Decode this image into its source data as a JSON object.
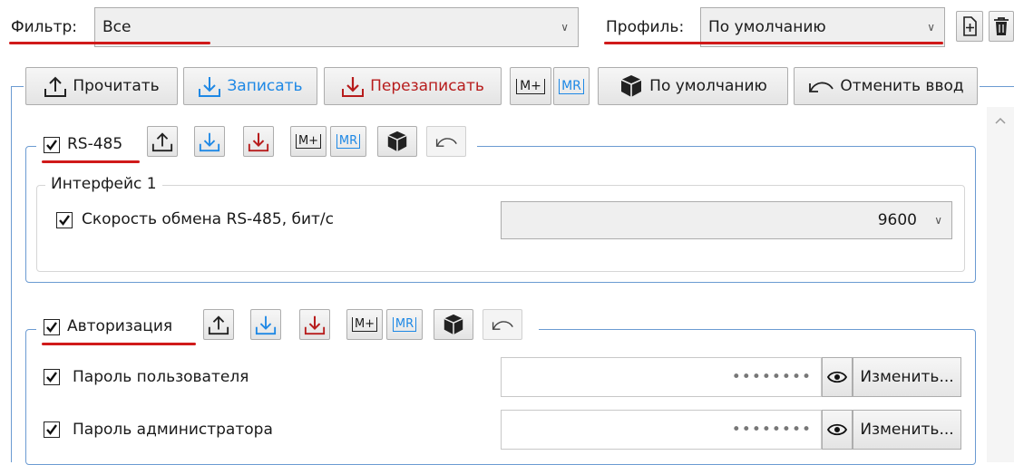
{
  "filter": {
    "label": "Фильтр:",
    "value": "Все"
  },
  "profile": {
    "label": "Профиль:",
    "value": "По умолчанию"
  },
  "toolbar": {
    "read": "Прочитать",
    "write": "Записать",
    "overwrite": "Перезаписать",
    "mem_store": "M+",
    "mem_recall": "MR",
    "defaults": "По умолчанию",
    "undo": "Отменить ввод"
  },
  "rs485": {
    "title": "RS-485",
    "mem_store": "M+",
    "mem_recall": "MR",
    "interface": {
      "title": "Интерфейс 1",
      "baud_label": "Скорость обмена RS-485, бит/с",
      "baud_value": "9600"
    }
  },
  "auth": {
    "title": "Авторизация",
    "mem_store": "M+",
    "mem_recall": "MR",
    "user_password_label": "Пароль пользователя",
    "admin_password_label": "Пароль администратора",
    "masked": "••••••••",
    "change": "Изменить..."
  },
  "icons": [
    "chevron-down-icon",
    "add-profile-icon",
    "trash-icon",
    "upload-icon",
    "download-icon",
    "cube-icon",
    "undo-icon",
    "eye-icon",
    "checkmark-icon",
    "scroll-up-icon"
  ],
  "colors": {
    "write_blue": "#1e88e5",
    "overwrite_red": "#b71c1c",
    "group_border": "#6b9bd2",
    "highlight_red": "#d01a1a"
  }
}
